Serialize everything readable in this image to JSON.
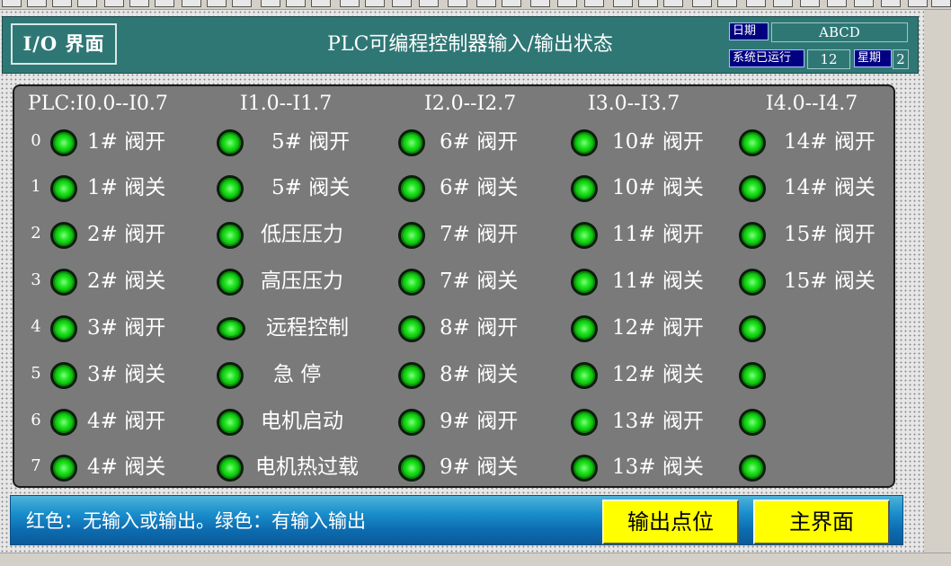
{
  "header": {
    "screen_tag": "I/O 界面",
    "title": "PLC可编程控制器输入/输出状态",
    "date_label": "日期",
    "date_value": "ABCD",
    "runtime_label": "系统已运行",
    "runtime_value": "12",
    "weekday_label": "星期",
    "weekday_value": "2"
  },
  "ranges": [
    "PLC:I0.0--I0.7",
    "I1.0--I1.7",
    "I2.0--I2.7",
    "I3.0--I3.7",
    "I4.0--I4.7"
  ],
  "row_numbers": [
    "0",
    "1",
    "2",
    "3",
    "4",
    "5",
    "6",
    "7"
  ],
  "columns": [
    {
      "signals": [
        "1#  阀开",
        "1#  阀关",
        "2#  阀开",
        "2#  阀关",
        "3#  阀开",
        "3#  阀关",
        "4#  阀开",
        "4#  阀关"
      ]
    },
    {
      "signals": [
        "5#  阀开",
        "5#  阀关",
        "低压压力",
        "高压压力",
        "远程控制",
        "急  停",
        "电机启动",
        "电机热过载"
      ]
    },
    {
      "signals": [
        "6#  阀开",
        "6#  阀关",
        "7#  阀开",
        "7#  阀关",
        "8#  阀开",
        "8#  阀关",
        "9#  阀开",
        "9#  阀关"
      ]
    },
    {
      "signals": [
        "10#  阀开",
        "10#  阀关",
        "11#  阀开",
        "11#  阀关",
        "12#  阀开",
        "12#  阀关",
        "13#  阀开",
        "13#  阀关"
      ]
    },
    {
      "signals": [
        "14#  阀开",
        "14#  阀关",
        "15#  阀开",
        "15#  阀关",
        "",
        "",
        "",
        ""
      ]
    }
  ],
  "indicator_states": "all-green",
  "colors": {
    "header_bg": "#2f7775",
    "panel_bg": "#7a7a7a",
    "led_on": "#1ee01e",
    "button_bg": "#ffff00",
    "footer_bg": "#0d6cb0"
  },
  "footer": {
    "legend": "红色：无输入或输出。绿色：有输入输出",
    "output_button": "输出点位",
    "main_button": "主界面"
  }
}
